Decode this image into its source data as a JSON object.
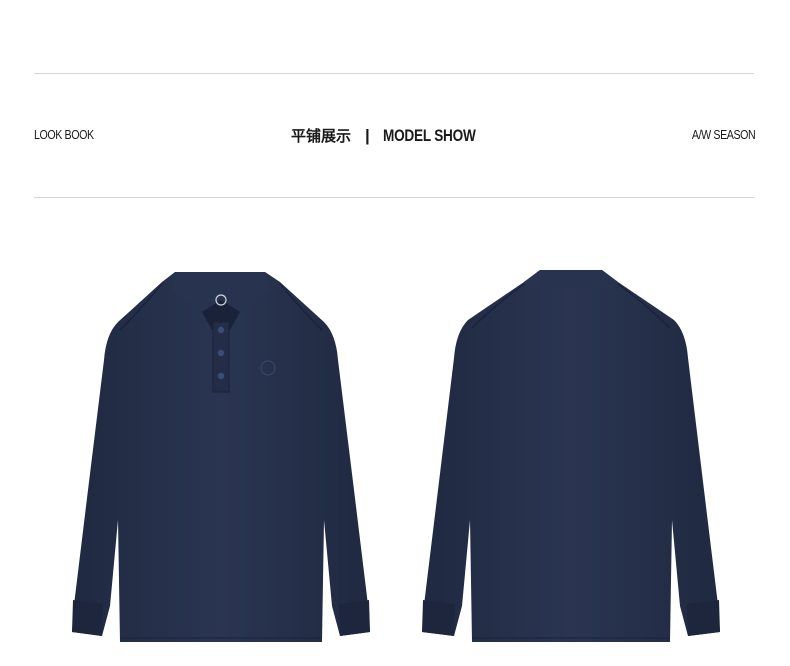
{
  "header": {
    "left_label": "LOOK BOOK",
    "center_cn": "平铺展示",
    "separator": "|",
    "center_en": "MODEL SHOW",
    "right_label": "A/W SEASON"
  },
  "products": [
    {
      "view": "front",
      "garment": "long-sleeve polo shirt",
      "color": "#25304a"
    },
    {
      "view": "back",
      "garment": "long-sleeve polo shirt",
      "color": "#25304a"
    }
  ],
  "colors": {
    "background": "#ffffff",
    "rule": "#d4d4d4",
    "text": "#1a1a1a",
    "shirt": "#25304a"
  }
}
